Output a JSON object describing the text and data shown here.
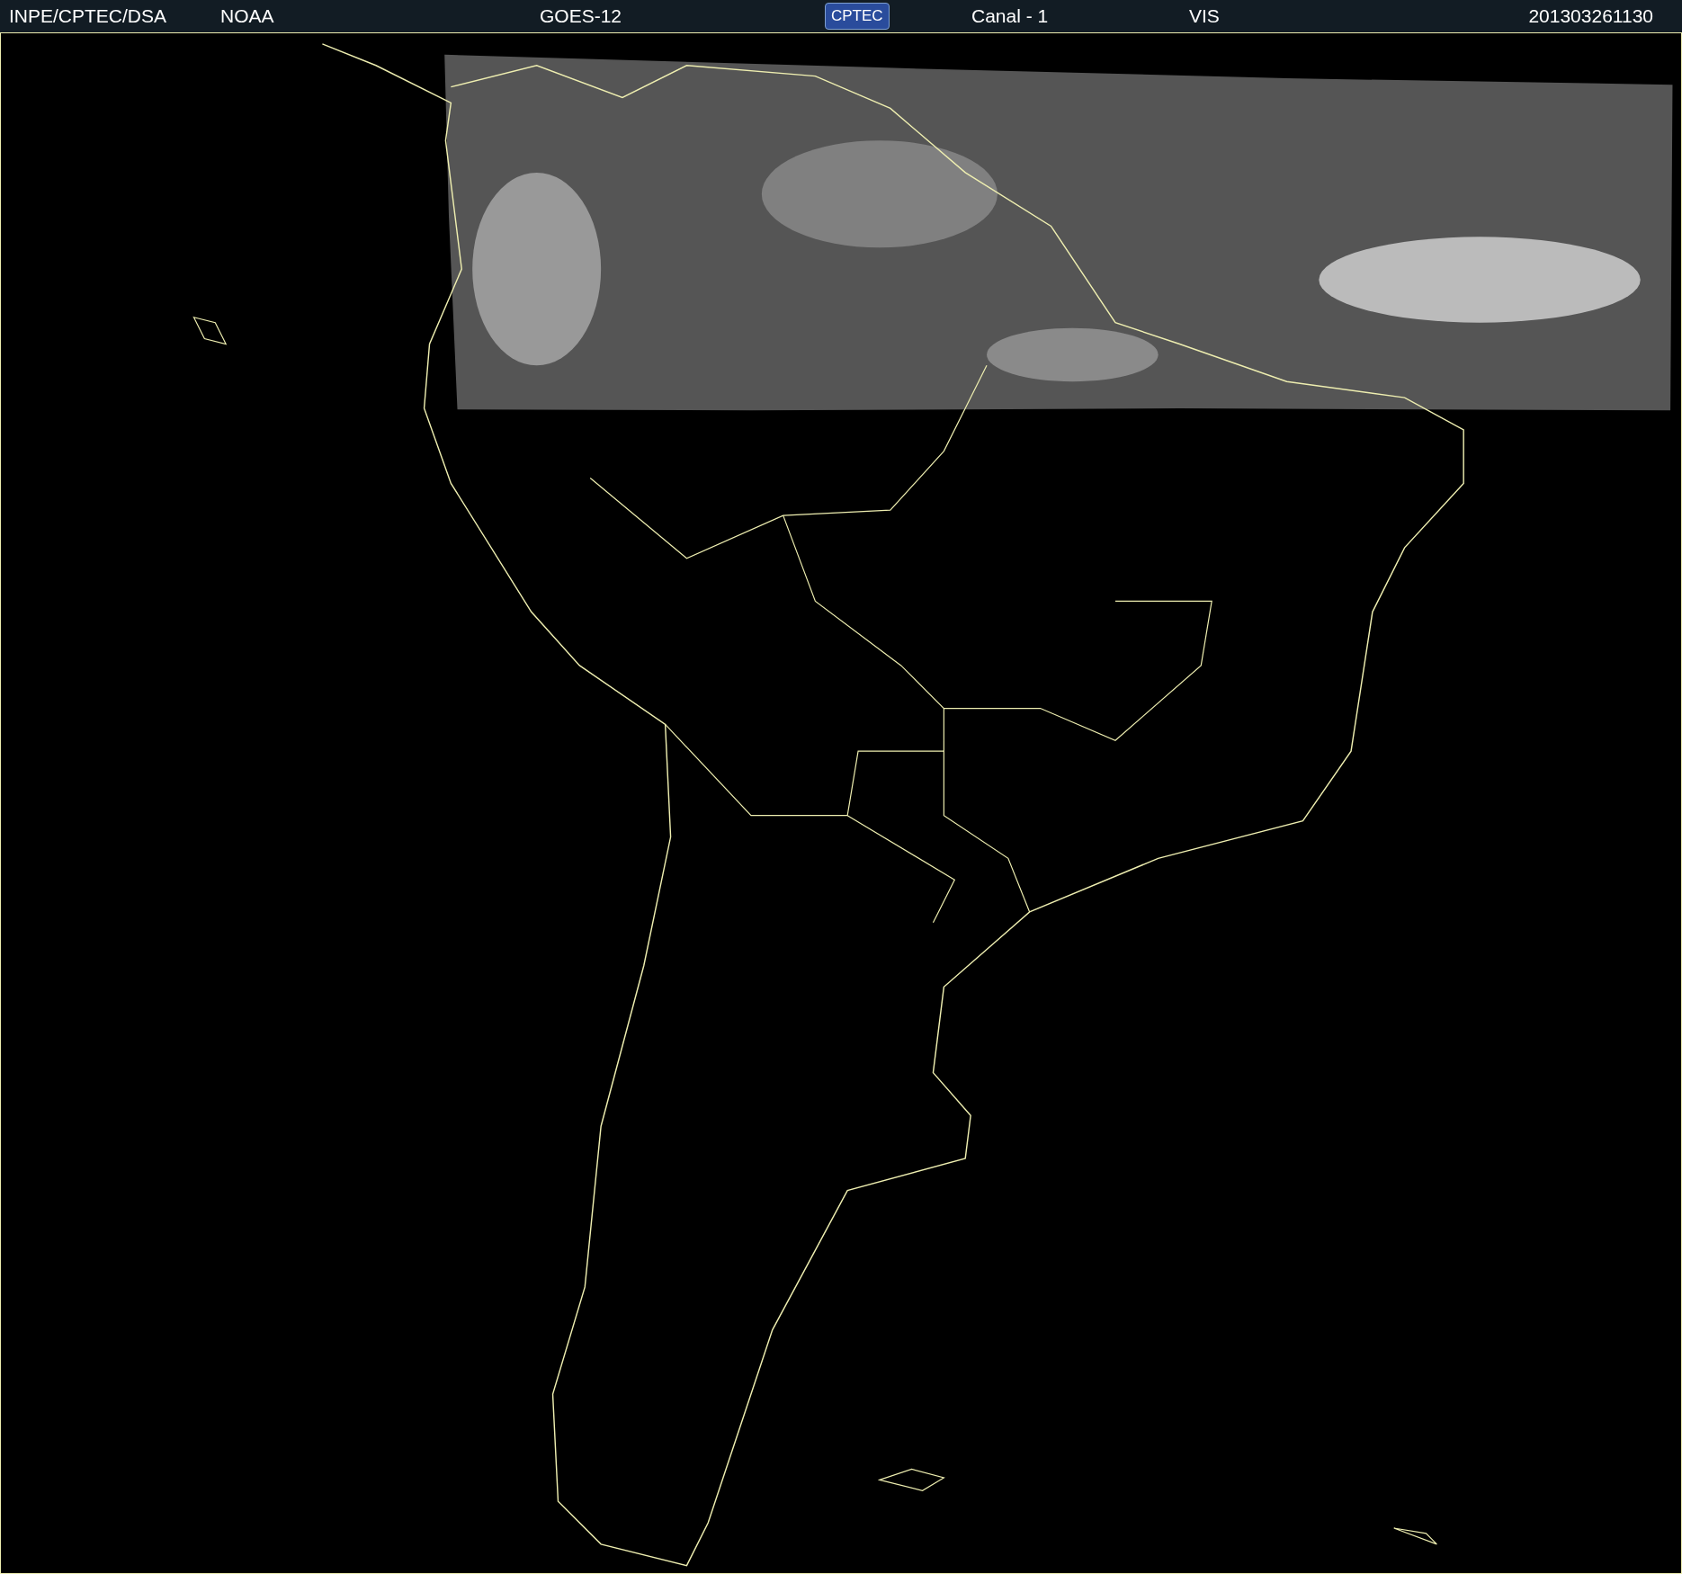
{
  "header": {
    "items": [
      {
        "kind": "text",
        "text": "INPE/CPTEC/DSA"
      },
      {
        "kind": "text",
        "text": "NOAA"
      },
      {
        "kind": "text",
        "text": "GOES-12"
      },
      {
        "kind": "logo",
        "text": "CPTEC"
      },
      {
        "kind": "text",
        "text": "Canal - 1"
      },
      {
        "kind": "text",
        "text": "VIS"
      },
      {
        "kind": "text",
        "text": "201303261130"
      }
    ]
  }
}
